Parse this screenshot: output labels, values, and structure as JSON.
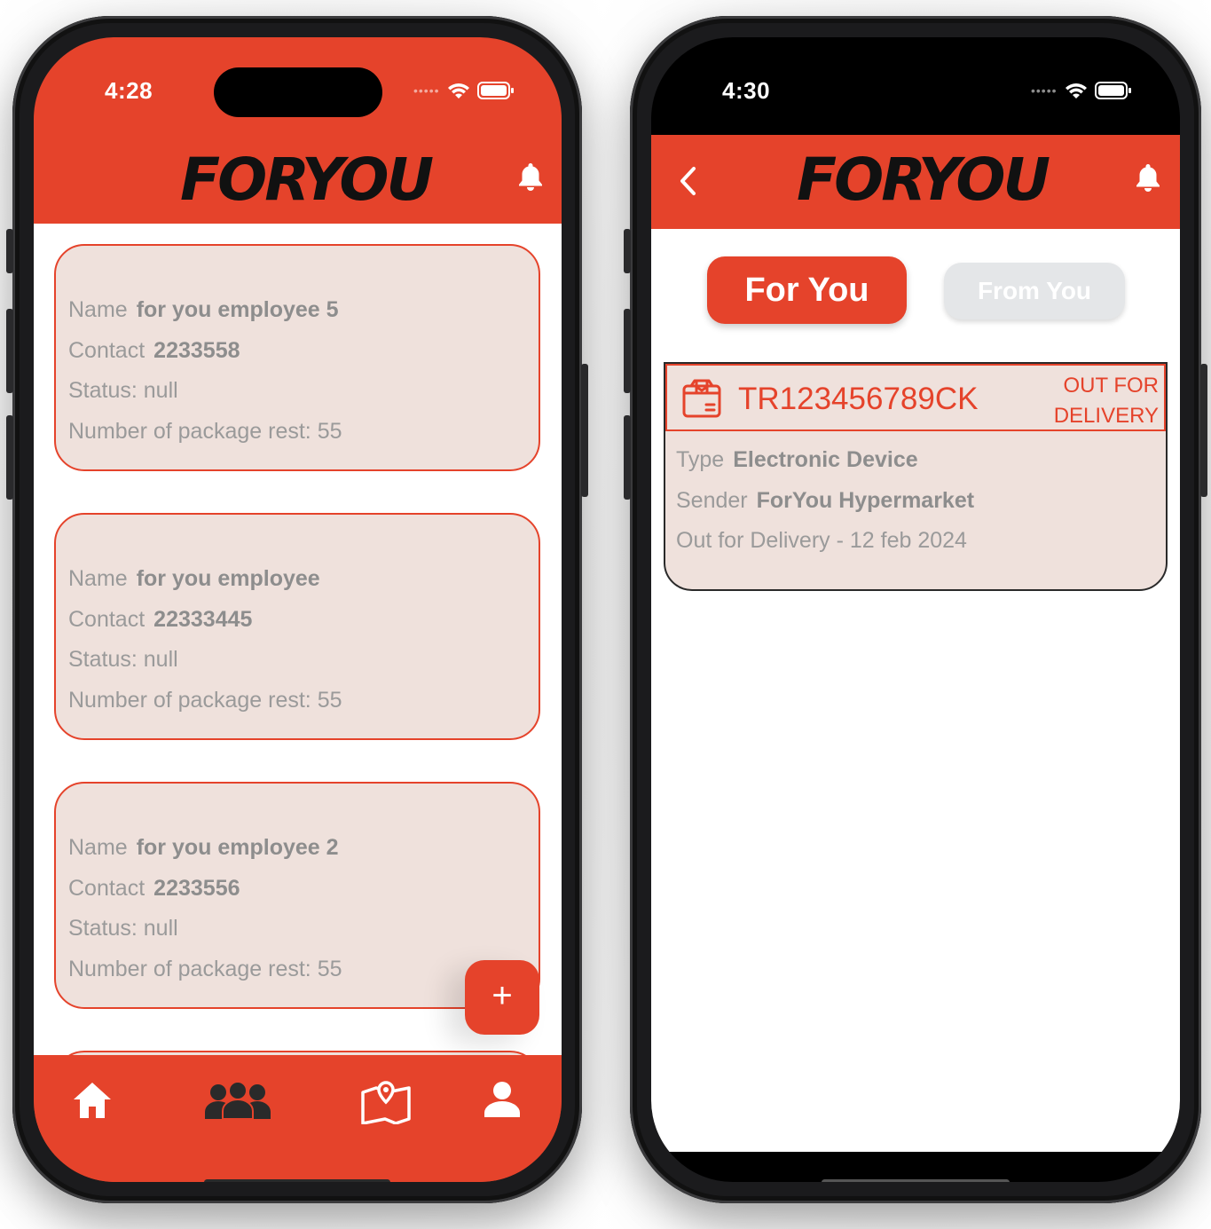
{
  "left_phone": {
    "status_time": "4:28",
    "logo": {
      "part1": "FOR",
      "part2": "YOU"
    },
    "employees": [
      {
        "name_label": "Name",
        "name": "for you employee 5",
        "contact_label": "Contact",
        "contact": "2233558",
        "status": "Status: null",
        "packages": "Number of package rest: 55"
      },
      {
        "name_label": "Name",
        "name": "for you employee",
        "contact_label": "Contact",
        "contact": "22333445",
        "status": "Status: null",
        "packages": "Number of package rest: 55"
      },
      {
        "name_label": "Name",
        "name": "for you employee 2",
        "contact_label": "Contact",
        "contact": "2233556",
        "status": "Status: null",
        "packages": "Number of package rest: 55"
      }
    ],
    "fab_label": "+",
    "tabs": [
      "home-icon",
      "team-icon",
      "map-icon",
      "profile-icon"
    ]
  },
  "right_phone": {
    "status_time": "4:30",
    "logo": {
      "part1": "FOR",
      "part2": "YOU"
    },
    "segments": {
      "active": "For You",
      "inactive": "From You"
    },
    "package": {
      "tracking": "TR123456789CK",
      "status_line1": "OUT FOR",
      "status_line2": "DELIVERY",
      "type_label": "Type",
      "type": "Electronic Device",
      "sender_label": "Sender",
      "sender": "ForYou Hypermarket",
      "delivery": "Out for Delivery - 12 feb 2024"
    }
  },
  "colors": {
    "accent": "#e5432b",
    "card_bg": "#efe1dc",
    "muted_text": "#9a9a9a"
  }
}
